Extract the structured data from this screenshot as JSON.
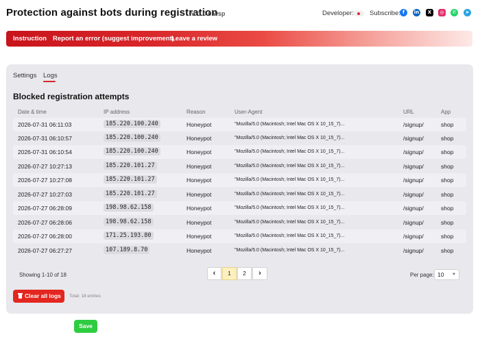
{
  "header": {
    "title": "Protection against bots during registration",
    "version": "v. 1.0.0.wsp",
    "developer_label": "Developer:",
    "subscribe_label": "Subscribe:",
    "social": [
      {
        "name": "facebook-icon",
        "glyph": "f",
        "color": "#1877f2"
      },
      {
        "name": "linkedin-icon",
        "glyph": "in",
        "color": "#0a66c2"
      },
      {
        "name": "x-icon",
        "glyph": "X",
        "color": "#000000"
      },
      {
        "name": "instagram-icon",
        "glyph": "◎",
        "color": "#e1306c"
      },
      {
        "name": "whatsapp-icon",
        "glyph": "✆",
        "color": "#25d366"
      },
      {
        "name": "telegram-icon",
        "glyph": "➤",
        "color": "#2aa3df"
      }
    ]
  },
  "nav": {
    "instruction": "Instruction",
    "report": "Report an error (suggest improvement)",
    "review": "Leave a review"
  },
  "tabs": {
    "settings": "Settings",
    "logs": "Logs",
    "active": "Logs"
  },
  "section_title": "Blocked registration attempts",
  "table": {
    "headers": {
      "date": "Date & time",
      "ip": "IP address",
      "reason": "Reason",
      "ua": "User-Agent",
      "url": "URL",
      "app": "App"
    },
    "rows": [
      {
        "date": "2026-07-31 06:11:03",
        "ip": "185.220.100.240",
        "reason": "Honeypot",
        "ua": "\"Mozilla/5.0 (Macintosh; Intel Mac OS X 10_15_7)...",
        "url": "/signup/",
        "app": "shop"
      },
      {
        "date": "2026-07-31 06:10:57",
        "ip": "185.220.100.240",
        "reason": "Honeypot",
        "ua": "\"Mozilla/5.0 (Macintosh; Intel Mac OS X 10_15_7)...",
        "url": "/signup/",
        "app": "shop"
      },
      {
        "date": "2026-07-31 06:10:54",
        "ip": "185.220.100.240",
        "reason": "Honeypot",
        "ua": "\"Mozilla/5.0 (Macintosh; Intel Mac OS X 10_15_7)...",
        "url": "/signup/",
        "app": "shop"
      },
      {
        "date": "2026-07-27 10:27:13",
        "ip": "185.220.101.27",
        "reason": "Honeypot",
        "ua": "\"Mozilla/5.0 (Macintosh; Intel Mac OS X 10_15_7)...",
        "url": "/signup/",
        "app": "shop"
      },
      {
        "date": "2026-07-27 10:27:08",
        "ip": "185.220.101.27",
        "reason": "Honeypot",
        "ua": "\"Mozilla/5.0 (Macintosh; Intel Mac OS X 10_15_7)...",
        "url": "/signup/",
        "app": "shop"
      },
      {
        "date": "2026-07-27 10:27:03",
        "ip": "185.220.101.27",
        "reason": "Honeypot",
        "ua": "\"Mozilla/5.0 (Macintosh; Intel Mac OS X 10_15_7)...",
        "url": "/signup/",
        "app": "shop"
      },
      {
        "date": "2026-07-27 06:28:09",
        "ip": "198.98.62.158",
        "reason": "Honeypot",
        "ua": "\"Mozilla/5.0 (Macintosh; Intel Mac OS X 10_15_7)...",
        "url": "/signup/",
        "app": "shop"
      },
      {
        "date": "2026-07-27 06:28:06",
        "ip": "198.98.62.158",
        "reason": "Honeypot",
        "ua": "\"Mozilla/5.0 (Macintosh; Intel Mac OS X 10_15_7)...",
        "url": "/signup/",
        "app": "shop"
      },
      {
        "date": "2026-07-27 06:28:00",
        "ip": "171.25.193.80",
        "reason": "Honeypot",
        "ua": "\"Mozilla/5.0 (Macintosh; Intel Mac OS X 10_15_7)...",
        "url": "/signup/",
        "app": "shop"
      },
      {
        "date": "2026-07-27 06:27:27",
        "ip": "107.189.8.70",
        "reason": "Honeypot",
        "ua": "\"Mozilla/5.0 (Macintosh; Intel Mac OS X 10_15_7)...",
        "url": "/signup/",
        "app": "shop"
      }
    ]
  },
  "pagination": {
    "showing": "Showing 1-10 of 18",
    "prev": "‹",
    "next": "›",
    "pages": [
      "1",
      "2"
    ],
    "current_page": "1",
    "per_page_label": "Per page:",
    "per_page_value": "10"
  },
  "actions": {
    "clear_label": "Clear all logs",
    "total": "Total: 18 entries",
    "save_label": "Save"
  }
}
